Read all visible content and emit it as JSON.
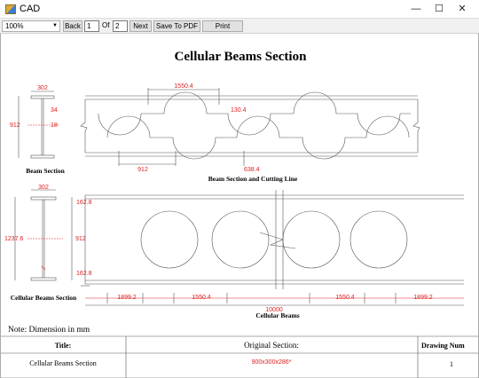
{
  "window": {
    "title": "CAD",
    "minimize": "—",
    "maximize": "☐",
    "close": "✕"
  },
  "toolbar": {
    "zoom": "100%",
    "back_label": "Back",
    "page_value": "1",
    "of_label": "Of",
    "total_pages": "2",
    "next_label": "Next",
    "save_pdf_label": "Save To PDF",
    "print_label": "Print"
  },
  "drawing": {
    "title": "Cellular Beams Section",
    "beam_section": {
      "caption": "Beam Section",
      "width": "302",
      "height": "912",
      "flange_thickness": "34",
      "web_thickness": "18"
    },
    "cutting": {
      "caption": "Beam Section and Cutting Line",
      "spacing": "1550.4",
      "offset": "130.4",
      "height": "912",
      "cut_depth": "638.4"
    },
    "cellular_section": {
      "caption": "Cellular Beams Section",
      "width": "302",
      "height": "1237.6",
      "flange_zone": "162.8",
      "hole_diameter": "912",
      "flange_zone_bottom": "162.8"
    },
    "cellular_beams": {
      "caption": "Cellular Beams",
      "end_left": "1899.2",
      "spacing_left": "1550.4",
      "spacing_right": "1550.4",
      "end_right": "1899.2",
      "total_length": "10000"
    },
    "note": "Note: Dimension in mm",
    "title_block": {
      "title_header": "Title:",
      "title_value": "Cellular Beams Section",
      "original_header": "Original Section:",
      "original_value": "900x300x286*",
      "drawing_header": "Drawing Num",
      "drawing_value": "1"
    }
  }
}
